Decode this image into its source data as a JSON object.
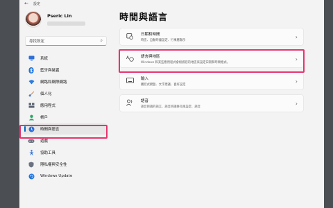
{
  "window": {
    "title": "設定"
  },
  "profile": {
    "name": "Pseric Lin"
  },
  "search": {
    "placeholder": "尋找設定"
  },
  "nav": {
    "items": [
      {
        "label": "系統",
        "icon": "monitor-icon",
        "color": "#2f6fd6"
      },
      {
        "label": "藍牙與裝置",
        "icon": "bluetooth-icon",
        "color": "#1e73d9"
      },
      {
        "label": "網路和網際網路",
        "icon": "wifi-icon",
        "color": "#2b7ae0"
      },
      {
        "label": "個人化",
        "icon": "brush-icon",
        "color": "#d2843a"
      },
      {
        "label": "應用程式",
        "icon": "apps-icon",
        "color": "#5a6270"
      },
      {
        "label": "帳戶",
        "icon": "account-icon",
        "color": "#2fa36b"
      },
      {
        "label": "時間與語言",
        "icon": "globe-clock-icon",
        "color": "#2f6fd6",
        "active": true
      },
      {
        "label": "遊戲",
        "icon": "gamepad-icon",
        "color": "#6b7280"
      },
      {
        "label": "協助工具",
        "icon": "accessibility-icon",
        "color": "#2f6fd6"
      },
      {
        "label": "隱私權與安全性",
        "icon": "shield-icon",
        "color": "#6b7280"
      },
      {
        "label": "Windows Update",
        "icon": "update-icon",
        "color": "#1e73d9"
      }
    ]
  },
  "main": {
    "title": "時間與語言",
    "cards": [
      {
        "title": "日期和時間",
        "desc": "時區、自動時鐘設定、行事曆顯示",
        "icon": "calendar-clock-icon"
      },
      {
        "title": "語言與地區",
        "desc": "Windows 和某些應用程式會根據您的地區來設定日期和時間格式。",
        "icon": "language-region-icon"
      },
      {
        "title": "輸入",
        "desc": "觸控式鍵盤、文字建議、喜好設定",
        "icon": "keyboard-icon"
      },
      {
        "title": "語音",
        "desc": "語音辨識的語言、語音辨識麥克風設定、語音",
        "icon": "speech-icon"
      }
    ]
  },
  "highlight": {
    "color": "#e8336e"
  }
}
